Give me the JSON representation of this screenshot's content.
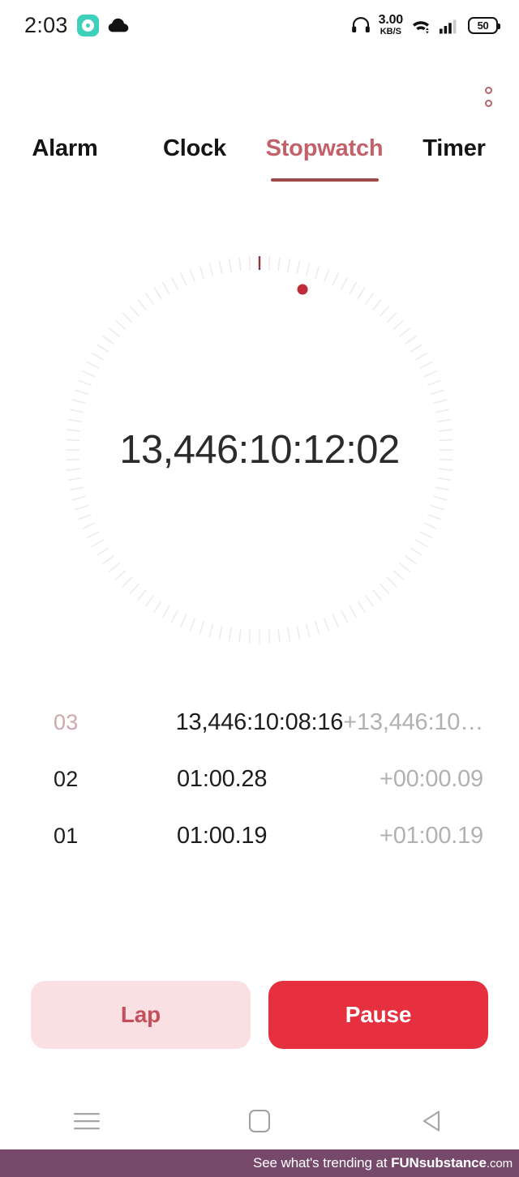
{
  "status_bar": {
    "clock": "2:03",
    "app_badge_icon": "teal-app-icon",
    "cloud_icon": "cloud-icon",
    "headphone_icon": "headphone-icon",
    "net_speed_rate": "3.00",
    "net_speed_unit": "KB/S",
    "wifi_icon": "wifi-icon",
    "signal_icon": "signal-bars-icon",
    "battery_level": "50"
  },
  "header": {
    "overflow_icon": "overflow-menu-icon"
  },
  "tabs": [
    {
      "label": "Alarm",
      "active": false
    },
    {
      "label": "Clock",
      "active": false
    },
    {
      "label": "Stopwatch",
      "active": true
    },
    {
      "label": "Timer",
      "active": false
    }
  ],
  "stopwatch": {
    "display_time": "13,446:10:12:02",
    "dial": {
      "tick_count": 120,
      "tick_color": "#eceaea",
      "marker_tick_color": "#8a3a3a",
      "marker_tick_angle_deg": 0,
      "indicator_dot_color": "#c02b3b",
      "indicator_dot_angle_deg": 15
    },
    "laps": [
      {
        "index": "03",
        "time": "13,446:10:08:16",
        "delta": "+13,446:10…",
        "newest": true
      },
      {
        "index": "02",
        "time": "01:00.28",
        "delta": "+00:00.09",
        "newest": false
      },
      {
        "index": "01",
        "time": "01:00.19",
        "delta": "+01:00.19",
        "newest": false
      }
    ],
    "lap_button_label": "Lap",
    "pause_button_label": "Pause"
  },
  "nav_bar": {
    "recents_icon": "menu-icon",
    "home_icon": "home-square-icon",
    "back_icon": "back-triangle-icon"
  },
  "watermark": {
    "prefix": "See what's trending at ",
    "brand_bold": "FUN",
    "brand_rest": "substance",
    "brand_tld": ".com"
  },
  "colors": {
    "accent_red": "#e7303f",
    "accent_rose": "#c2616a",
    "tab_underline": "#9e4b4b",
    "lap_button_bg": "#fadfe3",
    "watermark_bg": "#76496b",
    "app_badge_teal": "#3fd0bb"
  }
}
